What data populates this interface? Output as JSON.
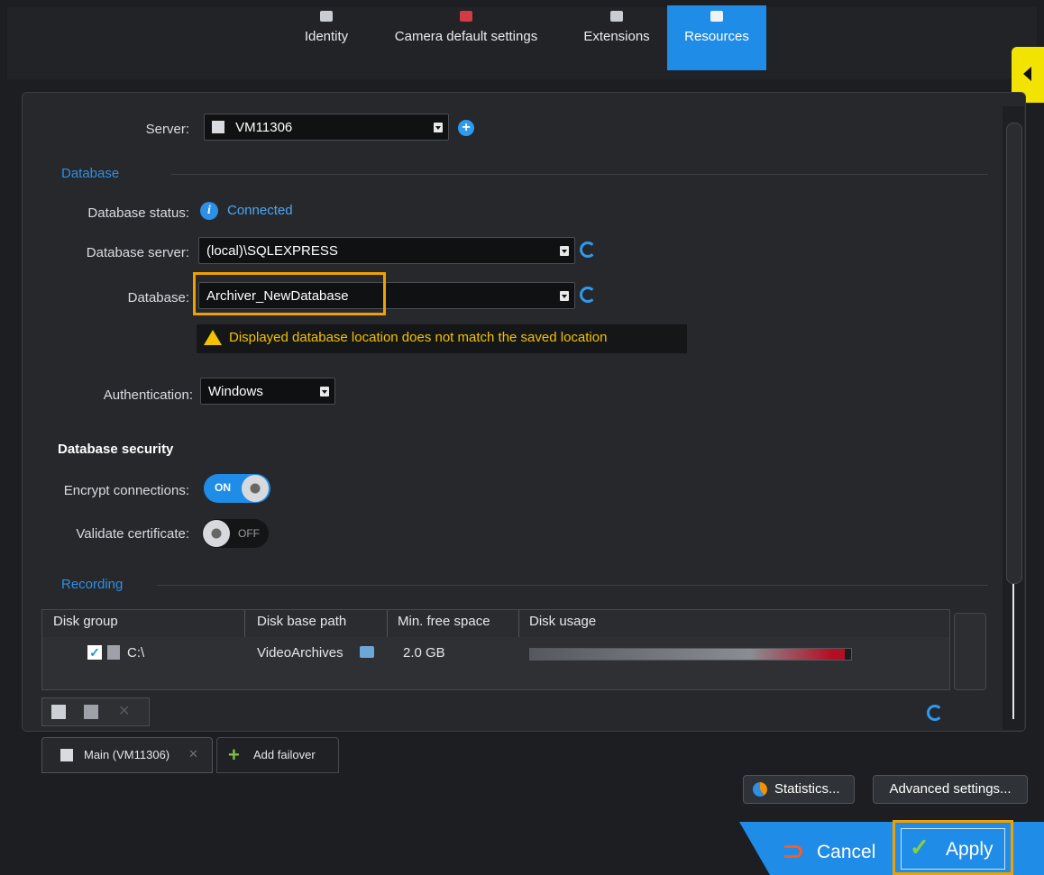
{
  "tabs": [
    {
      "label": "Identity",
      "icon": "identity-icon"
    },
    {
      "label": "Camera default settings",
      "icon": "camera-icon"
    },
    {
      "label": "Extensions",
      "icon": "extensions-icon"
    },
    {
      "label": "Resources",
      "icon": "resources-icon",
      "active": true
    }
  ],
  "server": {
    "label": "Server:",
    "value": "VM11306"
  },
  "database_section": {
    "title": "Database",
    "status_label": "Database status:",
    "status_value": "Connected",
    "server_label": "Database server:",
    "server_value": "(local)\\SQLEXPRESS",
    "db_label": "Database:",
    "db_value": "Archiver_NewDatabase",
    "warning": "Displayed database location does not match the saved location",
    "auth_label": "Authentication:",
    "auth_value": "Windows"
  },
  "security": {
    "title": "Database security",
    "encrypt_label": "Encrypt connections:",
    "encrypt_state": "ON",
    "validate_label": "Validate certificate:",
    "validate_state": "OFF"
  },
  "recording": {
    "title": "Recording",
    "columns": [
      "Disk group",
      "Disk base path",
      "Min. free space",
      "Disk usage"
    ],
    "rows": [
      {
        "group": "C:\\",
        "checked": true,
        "path": "VideoArchives",
        "min_free": "2.0 GB",
        "usage": 0.98
      }
    ]
  },
  "bottom_tabs": {
    "main": "Main (VM11306)",
    "add": "Add failover"
  },
  "buttons": {
    "statistics": "Statistics...",
    "advanced": "Advanced settings...",
    "cancel": "Cancel",
    "apply": "Apply"
  },
  "colors": {
    "accent": "#1f8ce8",
    "warning": "#f2c200",
    "highlight": "#f0a000"
  }
}
